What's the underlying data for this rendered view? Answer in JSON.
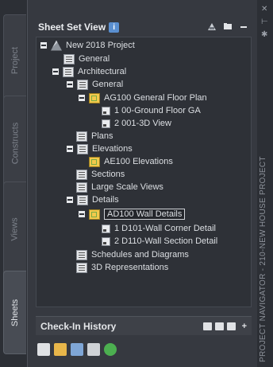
{
  "side_tabs": [
    {
      "label": "Project",
      "active": false
    },
    {
      "label": "Constructs",
      "active": false
    },
    {
      "label": "Views",
      "active": false
    },
    {
      "label": "Sheets",
      "active": true
    }
  ],
  "panel": {
    "title": "Sheet Set View",
    "toolbar_icons": [
      "sheet-set-icon",
      "folder-icon",
      "minimize-icon"
    ]
  },
  "tree": [
    {
      "label": "New 2018 Project",
      "icon": "sheet-set-icon",
      "expander": true
    },
    {
      "label": "General",
      "icon": "subset-icon",
      "expander": false
    },
    {
      "label": "Architectural",
      "icon": "subset-icon",
      "expander": true
    },
    {
      "label": "General",
      "icon": "subset-icon",
      "expander": true
    },
    {
      "label": "AG100 General Floor Plan",
      "icon": "sheet-icon",
      "expander": true
    },
    {
      "label": "1 00-Ground Floor GA",
      "icon": "view-icon",
      "expander": false
    },
    {
      "label": "2 001-3D View",
      "icon": "view-icon",
      "expander": false
    },
    {
      "label": "Plans",
      "icon": "subset-icon",
      "expander": false
    },
    {
      "label": "Elevations",
      "icon": "subset-icon",
      "expander": true
    },
    {
      "label": "AE100 Elevations",
      "icon": "sheet-icon",
      "expander": false
    },
    {
      "label": "Sections",
      "icon": "subset-icon",
      "expander": false
    },
    {
      "label": "Large Scale Views",
      "icon": "subset-icon",
      "expander": false
    },
    {
      "label": "Details",
      "icon": "subset-icon",
      "expander": true
    },
    {
      "label": "AD100 Wall Details",
      "icon": "sheet-icon",
      "expander": true,
      "selected": true
    },
    {
      "label": "1 D101-Wall Corner Detail",
      "icon": "view-icon",
      "expander": false
    },
    {
      "label": "2 D110-Wall Section Detail",
      "icon": "view-icon",
      "expander": false
    },
    {
      "label": "Schedules and Diagrams",
      "icon": "subset-icon",
      "expander": false
    },
    {
      "label": "3D Representations",
      "icon": "subset-icon",
      "expander": false
    }
  ],
  "checkin": {
    "label": "Check-In History",
    "icons": [
      "image-icon",
      "grid-icon",
      "list-icon",
      "add-icon"
    ]
  },
  "bottom_toolbar": [
    "printer-icon",
    "publish-icon",
    "filter-icon",
    "table-icon",
    "refresh-icon"
  ],
  "right_strip": {
    "title": "PROJECT NAVIGATOR - 210-NEW HOUSE PROJECT",
    "icons": [
      "close-icon",
      "pin-icon",
      "settings-icon"
    ]
  },
  "colors": {
    "accent": "#5a8fd0",
    "sheet": "#f2c94c",
    "panel_bg": "#363940"
  }
}
